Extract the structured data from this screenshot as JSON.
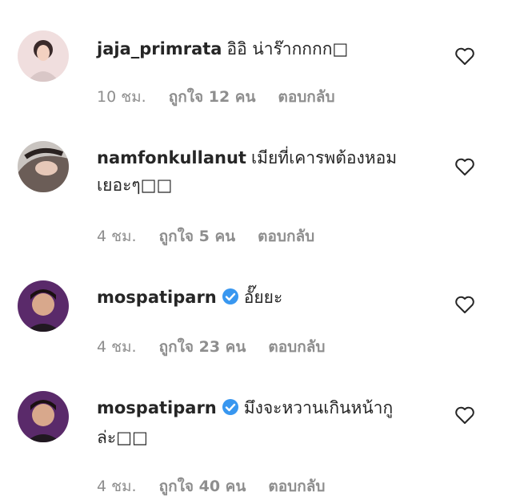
{
  "comments": [
    {
      "username": "jaja_primrata",
      "verified": false,
      "text": "อิอิ น่าร๊ากกกก□",
      "time": "10 ชม.",
      "likes": "ถูกใจ 12 คน",
      "reply": "ตอบกลับ",
      "avatar_icon": "avatar-photo"
    },
    {
      "username": "namfonkullanut",
      "verified": false,
      "text": "เมียที่เคารพต้องหอมเยอะๆ□□",
      "time": "4 ชม.",
      "likes": "ถูกใจ 5 คน",
      "reply": "ตอบกลับ",
      "avatar_icon": "avatar-photo"
    },
    {
      "username": "mospatiparn",
      "verified": true,
      "text": "อั๊ยยะ",
      "time": "4 ชม.",
      "likes": "ถูกใจ 23 คน",
      "reply": "ตอบกลับ",
      "avatar_icon": "avatar-photo"
    },
    {
      "username": "mospatiparn",
      "verified": true,
      "text": "มึงจะหวานเกินหน้ากูล่ะ□□",
      "time": "4 ชม.",
      "likes": "ถูกใจ 40 คน",
      "reply": "ตอบกลับ",
      "avatar_icon": "avatar-photo"
    }
  ],
  "colors": {
    "text": "#262626",
    "meta": "#8e8e8e",
    "verified": "#3897f0"
  },
  "icons": {
    "like": "heart-outline-icon",
    "verified": "verified-badge-icon"
  }
}
